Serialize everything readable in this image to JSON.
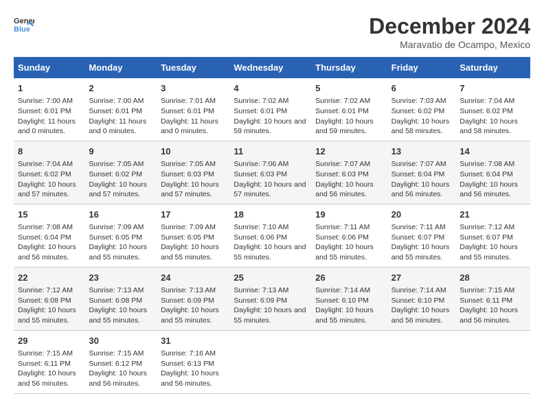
{
  "logo": {
    "general": "General",
    "blue": "Blue"
  },
  "title": "December 2024",
  "subtitle": "Maravatio de Ocampo, Mexico",
  "days_of_week": [
    "Sunday",
    "Monday",
    "Tuesday",
    "Wednesday",
    "Thursday",
    "Friday",
    "Saturday"
  ],
  "weeks": [
    [
      {
        "day": "1",
        "sunrise": "7:00 AM",
        "sunset": "6:01 PM",
        "daylight": "11 hours and 0 minutes."
      },
      {
        "day": "2",
        "sunrise": "7:00 AM",
        "sunset": "6:01 PM",
        "daylight": "11 hours and 0 minutes."
      },
      {
        "day": "3",
        "sunrise": "7:01 AM",
        "sunset": "6:01 PM",
        "daylight": "11 hours and 0 minutes."
      },
      {
        "day": "4",
        "sunrise": "7:02 AM",
        "sunset": "6:01 PM",
        "daylight": "10 hours and 59 minutes."
      },
      {
        "day": "5",
        "sunrise": "7:02 AM",
        "sunset": "6:01 PM",
        "daylight": "10 hours and 59 minutes."
      },
      {
        "day": "6",
        "sunrise": "7:03 AM",
        "sunset": "6:02 PM",
        "daylight": "10 hours and 58 minutes."
      },
      {
        "day": "7",
        "sunrise": "7:04 AM",
        "sunset": "6:02 PM",
        "daylight": "10 hours and 58 minutes."
      }
    ],
    [
      {
        "day": "8",
        "sunrise": "7:04 AM",
        "sunset": "6:02 PM",
        "daylight": "10 hours and 57 minutes."
      },
      {
        "day": "9",
        "sunrise": "7:05 AM",
        "sunset": "6:02 PM",
        "daylight": "10 hours and 57 minutes."
      },
      {
        "day": "10",
        "sunrise": "7:05 AM",
        "sunset": "6:03 PM",
        "daylight": "10 hours and 57 minutes."
      },
      {
        "day": "11",
        "sunrise": "7:06 AM",
        "sunset": "6:03 PM",
        "daylight": "10 hours and 57 minutes."
      },
      {
        "day": "12",
        "sunrise": "7:07 AM",
        "sunset": "6:03 PM",
        "daylight": "10 hours and 56 minutes."
      },
      {
        "day": "13",
        "sunrise": "7:07 AM",
        "sunset": "6:04 PM",
        "daylight": "10 hours and 56 minutes."
      },
      {
        "day": "14",
        "sunrise": "7:08 AM",
        "sunset": "6:04 PM",
        "daylight": "10 hours and 56 minutes."
      }
    ],
    [
      {
        "day": "15",
        "sunrise": "7:08 AM",
        "sunset": "6:04 PM",
        "daylight": "10 hours and 56 minutes."
      },
      {
        "day": "16",
        "sunrise": "7:09 AM",
        "sunset": "6:05 PM",
        "daylight": "10 hours and 55 minutes."
      },
      {
        "day": "17",
        "sunrise": "7:09 AM",
        "sunset": "6:05 PM",
        "daylight": "10 hours and 55 minutes."
      },
      {
        "day": "18",
        "sunrise": "7:10 AM",
        "sunset": "6:06 PM",
        "daylight": "10 hours and 55 minutes."
      },
      {
        "day": "19",
        "sunrise": "7:11 AM",
        "sunset": "6:06 PM",
        "daylight": "10 hours and 55 minutes."
      },
      {
        "day": "20",
        "sunrise": "7:11 AM",
        "sunset": "6:07 PM",
        "daylight": "10 hours and 55 minutes."
      },
      {
        "day": "21",
        "sunrise": "7:12 AM",
        "sunset": "6:07 PM",
        "daylight": "10 hours and 55 minutes."
      }
    ],
    [
      {
        "day": "22",
        "sunrise": "7:12 AM",
        "sunset": "6:08 PM",
        "daylight": "10 hours and 55 minutes."
      },
      {
        "day": "23",
        "sunrise": "7:13 AM",
        "sunset": "6:08 PM",
        "daylight": "10 hours and 55 minutes."
      },
      {
        "day": "24",
        "sunrise": "7:13 AM",
        "sunset": "6:09 PM",
        "daylight": "10 hours and 55 minutes."
      },
      {
        "day": "25",
        "sunrise": "7:13 AM",
        "sunset": "6:09 PM",
        "daylight": "10 hours and 55 minutes."
      },
      {
        "day": "26",
        "sunrise": "7:14 AM",
        "sunset": "6:10 PM",
        "daylight": "10 hours and 55 minutes."
      },
      {
        "day": "27",
        "sunrise": "7:14 AM",
        "sunset": "6:10 PM",
        "daylight": "10 hours and 56 minutes."
      },
      {
        "day": "28",
        "sunrise": "7:15 AM",
        "sunset": "6:11 PM",
        "daylight": "10 hours and 56 minutes."
      }
    ],
    [
      {
        "day": "29",
        "sunrise": "7:15 AM",
        "sunset": "6:11 PM",
        "daylight": "10 hours and 56 minutes."
      },
      {
        "day": "30",
        "sunrise": "7:15 AM",
        "sunset": "6:12 PM",
        "daylight": "10 hours and 56 minutes."
      },
      {
        "day": "31",
        "sunrise": "7:16 AM",
        "sunset": "6:13 PM",
        "daylight": "10 hours and 56 minutes."
      },
      null,
      null,
      null,
      null
    ]
  ],
  "labels": {
    "sunrise": "Sunrise:",
    "sunset": "Sunset:",
    "daylight": "Daylight:"
  }
}
